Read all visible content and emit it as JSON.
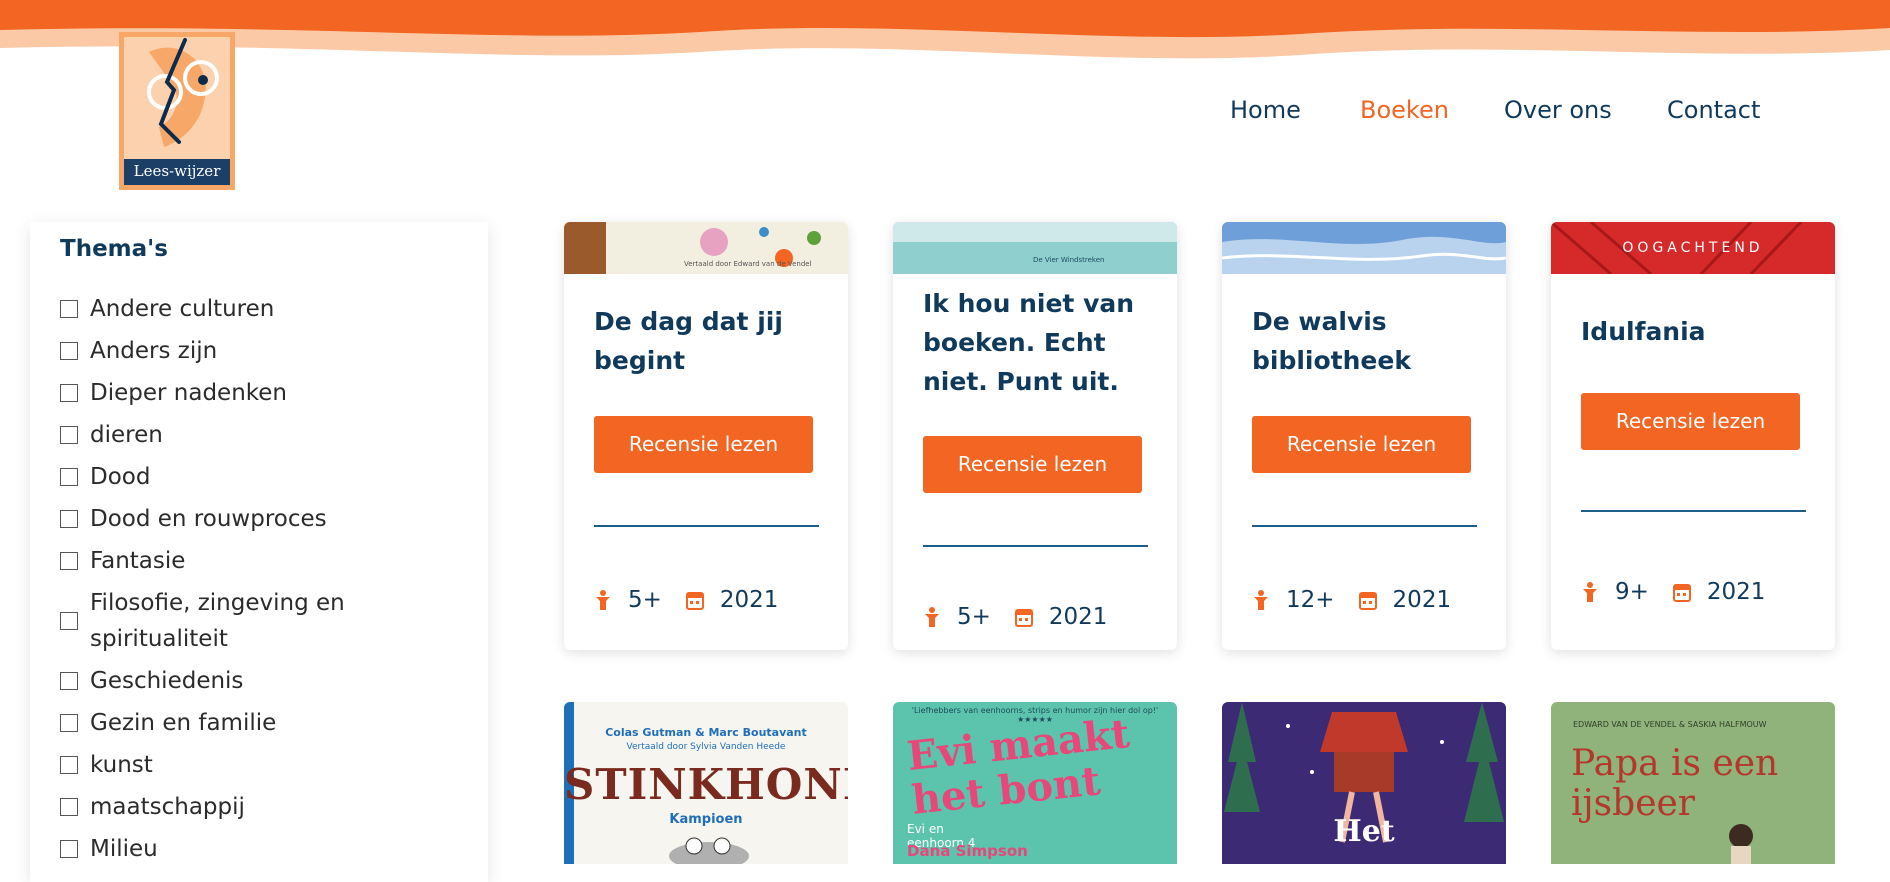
{
  "brand": {
    "logo_text": "Lees-wijzer"
  },
  "nav": {
    "items": [
      {
        "label": "Home",
        "active": false
      },
      {
        "label": "Boeken",
        "active": true
      },
      {
        "label": "Over ons",
        "active": false
      },
      {
        "label": "Contact",
        "active": false
      }
    ]
  },
  "sidebar": {
    "title": "Thema's",
    "themes": [
      "Andere culturen",
      "Anders zijn",
      "Dieper nadenken",
      "dieren",
      "Dood",
      "Dood en rouwproces",
      "Fantasie",
      "Filosofie, zingeving en spiritualiteit",
      "Geschiedenis",
      "Gezin en familie",
      "kunst",
      "maatschappij",
      "Milieu"
    ]
  },
  "cards": [
    {
      "title": "De dag dat jij begint",
      "button": "Recensie lezen",
      "age": "5+",
      "year": "2021",
      "cover_text": "Vertaald door Edward van de Vendel"
    },
    {
      "title": "Ik hou niet van boeken. Echt niet. Punt uit.",
      "button": "Recensie lezen",
      "age": "5+",
      "year": "2021",
      "cover_text": "De Vier Windstreken"
    },
    {
      "title": "De walvis bibliotheek",
      "button": "Recensie lezen",
      "age": "12+",
      "year": "2021",
      "cover_text": ""
    },
    {
      "title": "Idulfania",
      "button": "Recensie lezen",
      "age": "9+",
      "year": "2021",
      "cover_text": "OOGACHTEND"
    }
  ],
  "row2_covers": [
    {
      "authors": "Colas Gutman & Marc Boutavant",
      "translator": "Vertaald door Sylvia Vanden Heede",
      "title": "STINKHOND",
      "subtitle": "Kampioen"
    },
    {
      "quote": "'Liefhebbers van eenhoorns, strips en humor zijn hier dol op!' ★★★★★",
      "title": "Evi maakt het bont",
      "series": "Evi en eenhoorn 4",
      "author": "Dana Simpson"
    },
    {
      "title": "Het"
    },
    {
      "authors": "EDWARD VAN DE VENDEL & SASKIA HALFMOUW",
      "title": "Papa is een ijsbeer"
    }
  ],
  "colors": {
    "accent": "#f26522",
    "navy": "#103a5c"
  },
  "icons": {
    "age": "child-icon",
    "year": "calendar-icon"
  }
}
